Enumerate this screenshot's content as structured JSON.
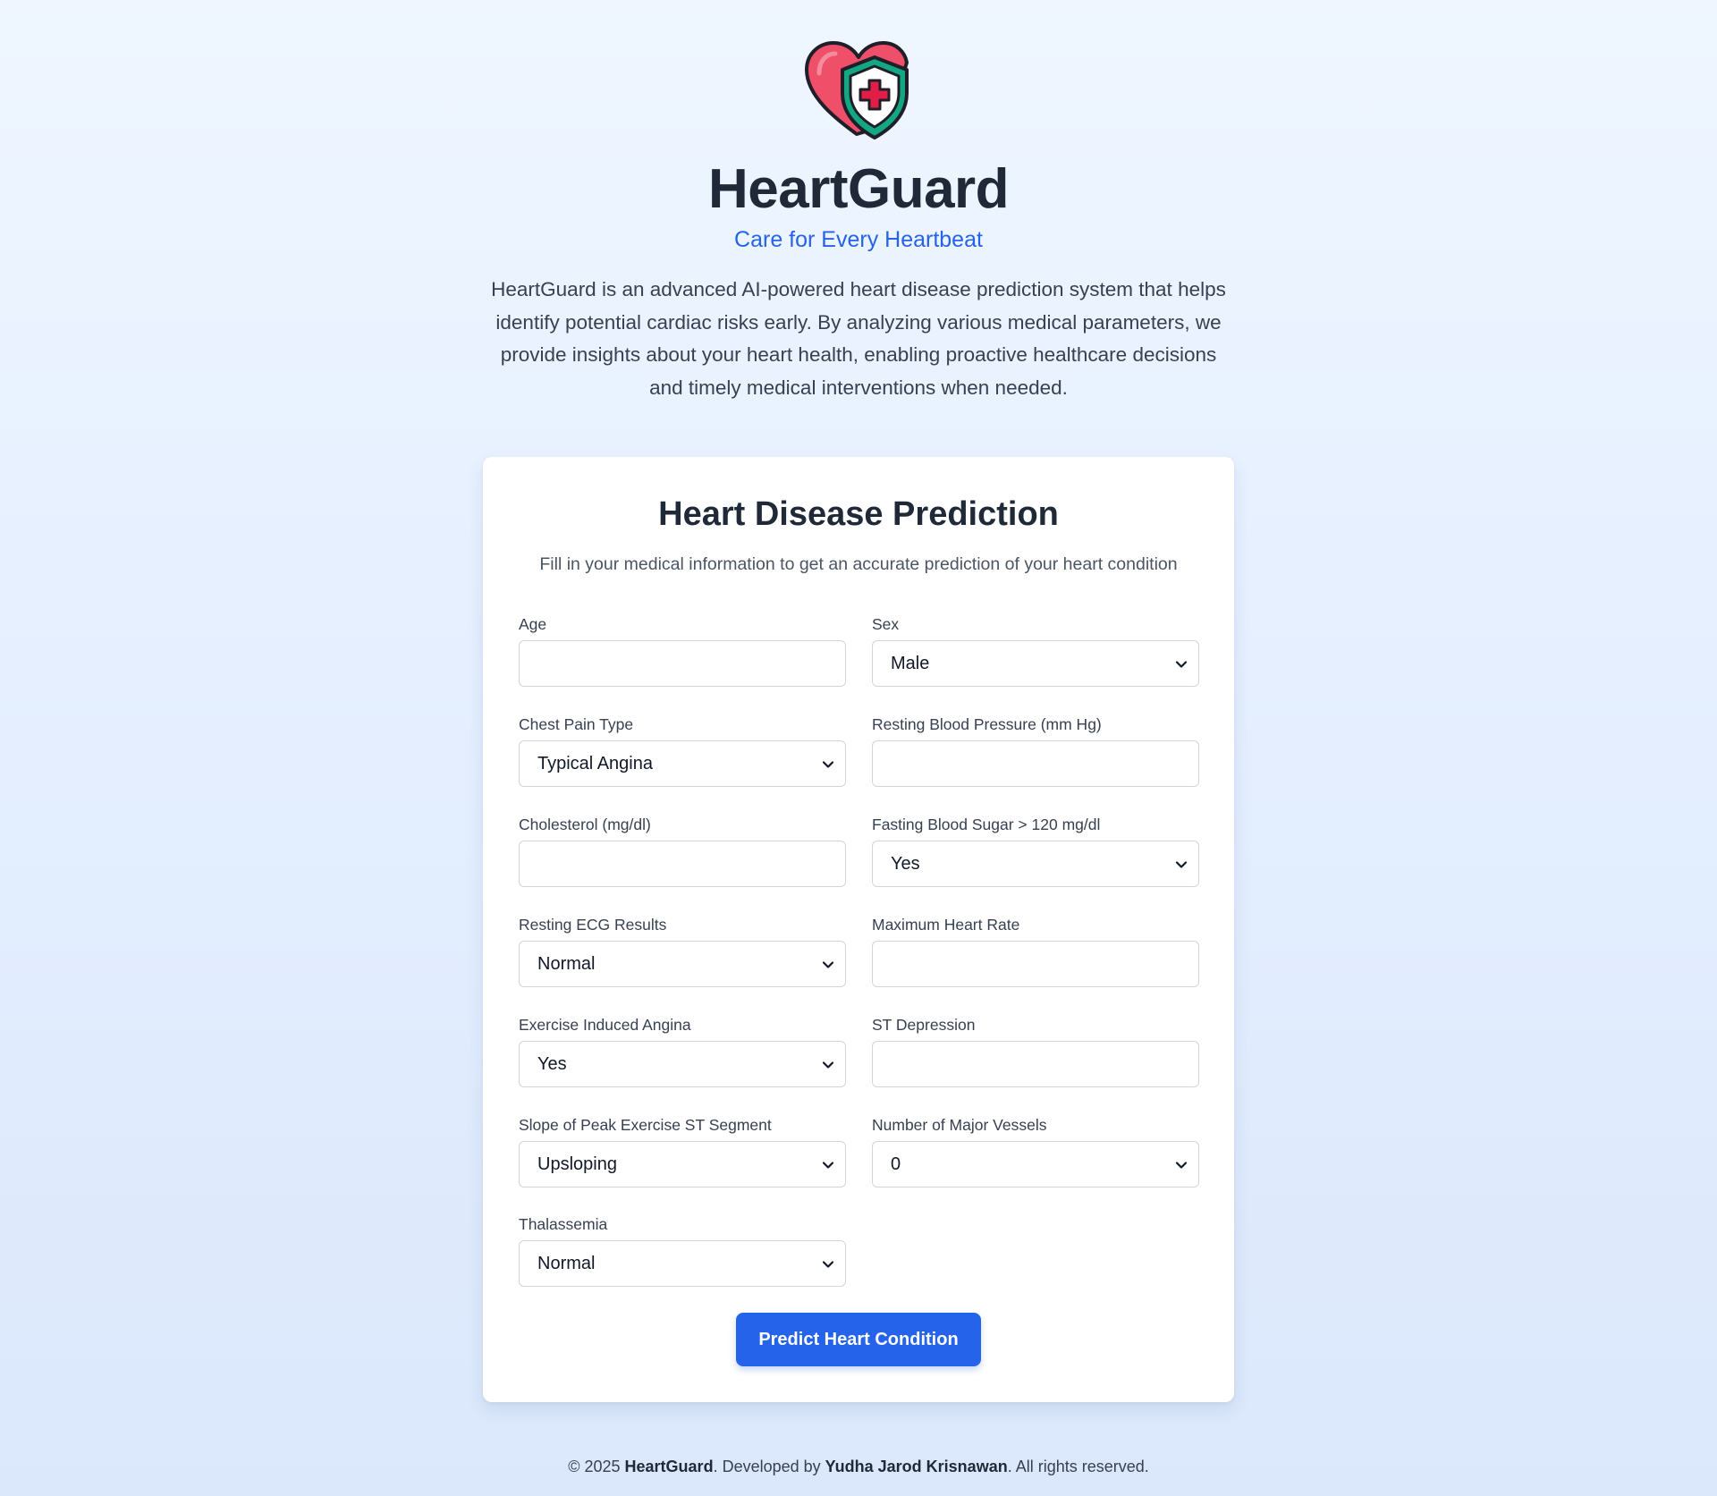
{
  "header": {
    "logo_icon": "heart-shield-icon",
    "title": "HeartGuard",
    "tagline": "Care for Every Heartbeat",
    "intro": "HeartGuard is an advanced AI-powered heart disease prediction system that helps identify potential cardiac risks early. By analyzing various medical parameters, we provide insights about your heart health, enabling proactive healthcare decisions and timely medical interventions when needed."
  },
  "form": {
    "title": "Heart Disease Prediction",
    "subtitle": "Fill in your medical information to get an accurate prediction of your heart condition",
    "fields": {
      "age": {
        "label": "Age",
        "value": ""
      },
      "sex": {
        "label": "Sex",
        "value": "Male"
      },
      "chest_pain": {
        "label": "Chest Pain Type",
        "value": "Typical Angina"
      },
      "resting_bp": {
        "label": "Resting Blood Pressure (mm Hg)",
        "value": ""
      },
      "cholesterol": {
        "label": "Cholesterol (mg/dl)",
        "value": ""
      },
      "fasting_bs": {
        "label": "Fasting Blood Sugar > 120 mg/dl",
        "value": "Yes"
      },
      "resting_ecg": {
        "label": "Resting ECG Results",
        "value": "Normal"
      },
      "max_hr": {
        "label": "Maximum Heart Rate",
        "value": ""
      },
      "exercise_angina": {
        "label": "Exercise Induced Angina",
        "value": "Yes"
      },
      "st_depression": {
        "label": "ST Depression",
        "value": ""
      },
      "slope": {
        "label": "Slope of Peak Exercise ST Segment",
        "value": "Upsloping"
      },
      "vessels": {
        "label": "Number of Major Vessels",
        "value": "0"
      },
      "thalassemia": {
        "label": "Thalassemia",
        "value": "Normal"
      }
    },
    "submit_label": "Predict Heart Condition"
  },
  "footer": {
    "prefix": "© 2025 ",
    "brand": "HeartGuard",
    "middle": ". Developed by ",
    "author": "Yudha Jarod Krisnawan",
    "suffix": ". All rights reserved."
  },
  "colors": {
    "accent": "#2563eb",
    "heart": "#ef4f68",
    "shield": "#14a882",
    "cross": "#e11d48",
    "text_dark": "#1f2937"
  }
}
